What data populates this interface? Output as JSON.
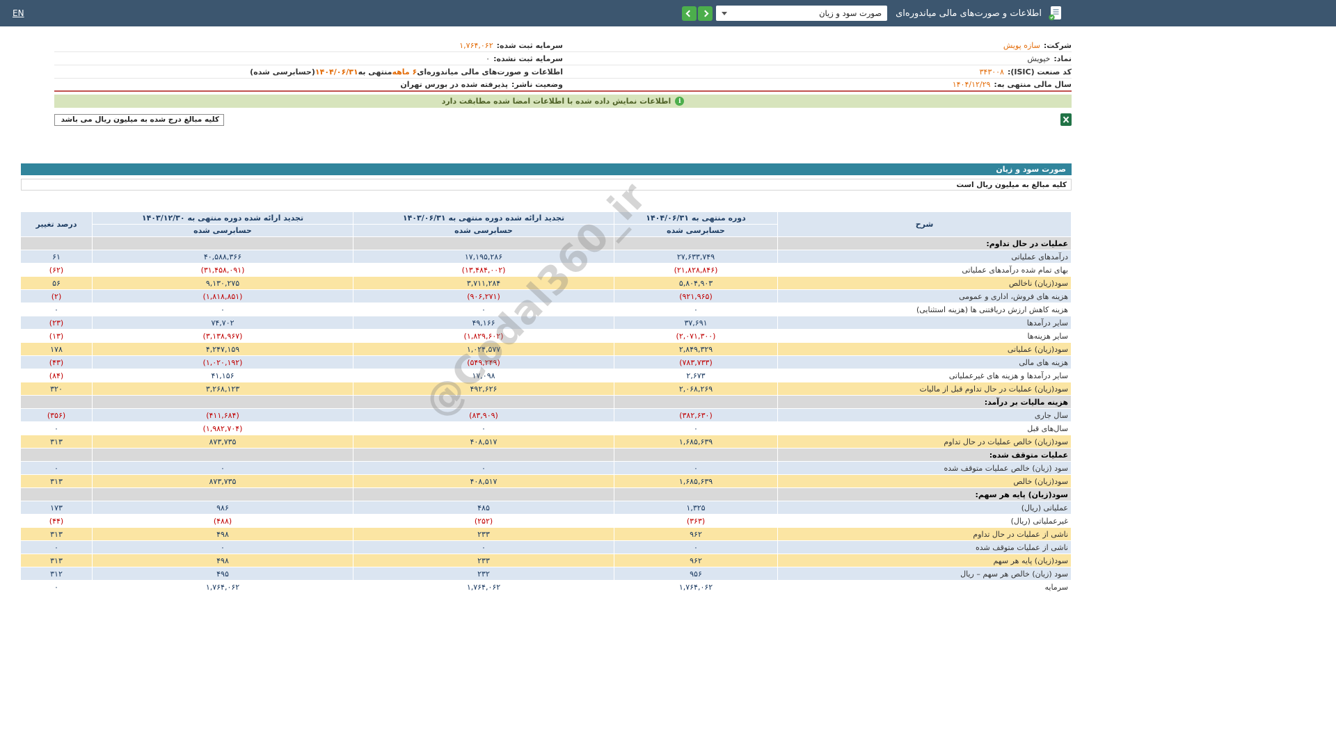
{
  "topbar": {
    "title": "اطلاعات و صورت‌های مالی میاندوره‌ای",
    "statement_select": "صورت سود و زیان",
    "en_link": "EN",
    "icons": {
      "app": "document-check-icon",
      "dropdown": "chevron-down-icon",
      "nav_forward": "chevron-right-icon",
      "nav_back": "chevron-left-icon"
    }
  },
  "company": {
    "right": [
      {
        "label": "شرکت:",
        "value": "سازه پویش"
      },
      {
        "label": "نماد:",
        "value": "خپویش"
      },
      {
        "label": "کد صنعت (ISIC):",
        "value": "۳۴۳۰۰۸"
      },
      {
        "label": "سال مالی منتهی به:",
        "value": "۱۴۰۴/۱۲/۲۹"
      }
    ],
    "left": [
      {
        "label": "سرمایه ثبت شده:",
        "value": "۱,۷۶۴,۰۶۲"
      },
      {
        "label": "سرمایه ثبت نشده:",
        "value": "۰"
      },
      {
        "parts": [
          "اطلاعات و صورت‌های مالی میاندوره‌ای ",
          "۶ ماهه",
          " منتهی به ",
          "۱۴۰۴/۰۶/۳۱",
          "(حسابرسی شده)"
        ]
      },
      {
        "label": "وضعیت ناشر:",
        "value": "پذیرفته شده در بورس تهران"
      }
    ]
  },
  "banner": {
    "text": "اطلاعات نمایش داده شده با اطلاعات امضا شده مطابقت دارد",
    "icon": "info-icon"
  },
  "export": {
    "excel_icon": "excel-export-icon",
    "units_note": "کلیه مبالغ درج شده به میلیون ریال می باشد"
  },
  "statement": {
    "title": "صورت سود و زیان",
    "units_note": "کلیه مبالغ به میلیون ریال است"
  },
  "table": {
    "headers": {
      "desc": "شرح",
      "current": "دوره منتهی به ۱۴۰۴/۰۶/۳۱",
      "restated_mid": "تجدید ارائه شده دوره منتهی به ۱۴۰۳/۰۶/۳۱",
      "restated_year": "تجدید ارائه شده دوره منتهی به ۱۴۰۳/۱۲/۳۰",
      "pct": "درصد تغییر",
      "audited": "حسابرسی شده"
    },
    "rows": [
      {
        "d": "عملیات در حال تداوم:",
        "v1": "",
        "v2": "",
        "v3": "",
        "p": "",
        "t": "section"
      },
      {
        "d": "درآمدهای عملیاتی",
        "v1": "۲۷,۶۳۳,۷۴۹",
        "v2": "۱۷,۱۹۵,۲۸۶",
        "v3": "۴۰,۵۸۸,۳۶۶",
        "p": "۶۱",
        "t": "blue"
      },
      {
        "d": "بهای تمام شده درآمدهای عملیاتی",
        "v1": "(۲۱,۸۲۸,۸۴۶)",
        "v2": "(۱۳,۴۸۴,۰۰۲)",
        "v3": "(۳۱,۴۵۸,۰۹۱)",
        "p": "(۶۲)",
        "t": "white"
      },
      {
        "d": "سود(زیان) ناخالص",
        "v1": "۵,۸۰۴,۹۰۳",
        "v2": "۳,۷۱۱,۲۸۴",
        "v3": "۹,۱۳۰,۲۷۵",
        "p": "۵۶",
        "t": "highlight"
      },
      {
        "d": "هزینه های فروش، اداری و عمومی",
        "v1": "(۹۲۱,۹۶۵)",
        "v2": "(۹۰۶,۲۷۱)",
        "v3": "(۱,۸۱۸,۸۵۱)",
        "p": "(۲)",
        "t": "blue"
      },
      {
        "d": "هزینه کاهش ارزش دریافتنی ها (هزینه استثنایی)",
        "v1": "۰",
        "v2": "۰",
        "v3": "۰",
        "p": "۰",
        "t": "white"
      },
      {
        "d": "سایر درآمدها",
        "v1": "۳۷,۶۹۱",
        "v2": "۴۹,۱۶۶",
        "v3": "۷۴,۷۰۲",
        "p": "(۲۳)",
        "t": "blue"
      },
      {
        "d": "سایر هزینه‌ها",
        "v1": "(۲,۰۷۱,۳۰۰)",
        "v2": "(۱,۸۲۹,۶۰۲)",
        "v3": "(۳,۱۳۸,۹۶۷)",
        "p": "(۱۳)",
        "t": "white"
      },
      {
        "d": "سود(زیان) عملیاتی",
        "v1": "۲,۸۴۹,۳۲۹",
        "v2": "۱,۰۲۴,۵۷۷",
        "v3": "۴,۲۴۷,۱۵۹",
        "p": "۱۷۸",
        "t": "highlight"
      },
      {
        "d": "هزینه های مالی",
        "v1": "(۷۸۳,۷۳۳)",
        "v2": "(۵۴۹,۲۴۹)",
        "v3": "(۱,۰۲۰,۱۹۲)",
        "p": "(۴۳)",
        "t": "blue"
      },
      {
        "d": "سایر درآمدها و هزینه های غیرعملیاتی",
        "v1": "۲,۶۷۳",
        "v2": "۱۷,۰۹۸",
        "v3": "۴۱,۱۵۶",
        "p": "(۸۴)",
        "t": "white"
      },
      {
        "d": "سود(زیان) عملیات در حال تداوم قبل از مالیات",
        "v1": "۲,۰۶۸,۲۶۹",
        "v2": "۴۹۲,۶۲۶",
        "v3": "۳,۲۶۸,۱۲۳",
        "p": "۳۲۰",
        "t": "highlight"
      },
      {
        "d": "هزینه مالیات بر درآمد:",
        "v1": "",
        "v2": "",
        "v3": "",
        "p": "",
        "t": "section"
      },
      {
        "d": "سال جاری",
        "v1": "(۳۸۲,۶۳۰)",
        "v2": "(۸۳,۹۰۹)",
        "v3": "(۴۱۱,۶۸۴)",
        "p": "(۳۵۶)",
        "t": "blue"
      },
      {
        "d": "سال‌های قبل",
        "v1": "۰",
        "v2": "۰",
        "v3": "(۱,۹۸۲,۷۰۴)",
        "p": "۰",
        "t": "white"
      },
      {
        "d": "سود(زیان) خالص عملیات در حال تداوم",
        "v1": "۱,۶۸۵,۶۳۹",
        "v2": "۴۰۸,۵۱۷",
        "v3": "۸۷۳,۷۳۵",
        "p": "۳۱۳",
        "t": "highlight"
      },
      {
        "d": "عملیات متوقف شده:",
        "v1": "",
        "v2": "",
        "v3": "",
        "p": "",
        "t": "section"
      },
      {
        "d": "سود (زیان) خالص عملیات متوقف شده",
        "v1": "۰",
        "v2": "۰",
        "v3": "۰",
        "p": "۰",
        "t": "blue"
      },
      {
        "d": "سود(زیان) خالص",
        "v1": "۱,۶۸۵,۶۳۹",
        "v2": "۴۰۸,۵۱۷",
        "v3": "۸۷۳,۷۳۵",
        "p": "۳۱۳",
        "t": "highlight"
      },
      {
        "d": "سود(زیان) پایه هر سهم:",
        "v1": "",
        "v2": "",
        "v3": "",
        "p": "",
        "t": "section"
      },
      {
        "d": "عملیاتی (ریال)",
        "v1": "۱,۳۲۵",
        "v2": "۴۸۵",
        "v3": "۹۸۶",
        "p": "۱۷۳",
        "t": "blue"
      },
      {
        "d": "غیرعملیاتی (ریال)",
        "v1": "(۳۶۳)",
        "v2": "(۲۵۲)",
        "v3": "(۴۸۸)",
        "p": "(۴۴)",
        "t": "white"
      },
      {
        "d": "ناشی از عملیات در حال تداوم",
        "v1": "۹۶۲",
        "v2": "۲۳۳",
        "v3": "۴۹۸",
        "p": "۳۱۳",
        "t": "highlight"
      },
      {
        "d": "ناشی از عملیات متوقف شده",
        "v1": "۰",
        "v2": "۰",
        "v3": "۰",
        "p": "۰",
        "t": "blue"
      },
      {
        "d": "سود(زیان) پایه هر سهم",
        "v1": "۹۶۲",
        "v2": "۲۳۳",
        "v3": "۴۹۸",
        "p": "۳۱۳",
        "t": "highlight"
      },
      {
        "d": "سود (زیان) خالص هر سهم – ریال",
        "v1": "۹۵۶",
        "v2": "۲۳۲",
        "v3": "۴۹۵",
        "p": "۳۱۲",
        "t": "blue"
      },
      {
        "d": "سرمایه",
        "v1": "۱,۷۶۴,۰۶۲",
        "v2": "۱,۷۶۴,۰۶۲",
        "v3": "۱,۷۶۴,۰۶۲",
        "p": "۰",
        "t": "white"
      }
    ]
  },
  "watermark": "@Codal360_ir",
  "colors": {
    "topbar": "#3c566f",
    "accent_orange": "#e36c09",
    "negative_red": "#c00000",
    "title_teal": "#31859c",
    "row_blue": "#dbe5f1",
    "highlight_yellow": "#fbe5a3",
    "section_gray": "#d9d9d9",
    "banner_green": "#d7e4bc",
    "button_green": "#4cae4c",
    "divider_red": "#c0504d"
  }
}
